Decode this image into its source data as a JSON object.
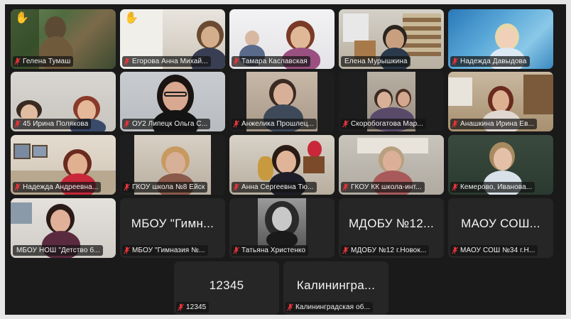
{
  "colors": {
    "tile_bg": "#262626",
    "active_border": "#23d959",
    "muted_mic": "#e8343a",
    "name_text": "#f2f2f2"
  },
  "hand_icon": "✋",
  "tiles": [
    {
      "name": "Гелена Тумаш",
      "type": "video",
      "hand": true
    },
    {
      "name": "Егорова Анна Михай...",
      "type": "video",
      "hand": true
    },
    {
      "name": "Тамара Каславская",
      "type": "video",
      "hand": false
    },
    {
      "name": "Елена Мурышкина",
      "type": "video",
      "hand": false,
      "active": true
    },
    {
      "name": "Надежда Давыдова",
      "type": "video",
      "hand": false
    },
    {
      "name": "45 Ирина Полякова",
      "type": "video",
      "hand": false
    },
    {
      "name": "ОУ2 Липецк Ольга С...",
      "type": "video",
      "hand": false
    },
    {
      "name": "Анжелика  Прошлец...",
      "type": "video",
      "hand": false
    },
    {
      "name": "Скоробогатова Мар...",
      "type": "video",
      "hand": false
    },
    {
      "name": "Анашкина Ирина Ев...",
      "type": "video",
      "hand": false
    },
    {
      "name": "Надежда Андреевна...",
      "type": "video",
      "hand": false
    },
    {
      "name": "ГКОУ школа №8 Ейск",
      "type": "video",
      "hand": false
    },
    {
      "name": "Анна Сергеевна Тю...",
      "type": "video",
      "hand": false
    },
    {
      "name": "ГКОУ КК школа-инт...",
      "type": "video",
      "hand": false
    },
    {
      "name": "Кемерово, Иванова...",
      "type": "video",
      "hand": false
    },
    {
      "name": "МБОУ НОШ \"Детство б...",
      "type": "video",
      "hand": false
    },
    {
      "name": "МБОУ \"Гимназия №...",
      "type": "label",
      "label": "МБОУ \"Гимн...",
      "hand": false
    },
    {
      "name": "Татьяна Христенко",
      "type": "photo",
      "hand": false
    },
    {
      "name": "МДОБУ №12 г.Новок...",
      "type": "label",
      "label": "МДОБУ №12...",
      "hand": false
    },
    {
      "name": "МАОУ СОШ №34 г.Н...",
      "type": "label",
      "label": "МАОУ СОШ...",
      "hand": false
    },
    {
      "name": "12345",
      "type": "label",
      "label": "12345",
      "hand": false
    },
    {
      "name": "Калининградская об...",
      "type": "label",
      "label": "Калинингра...",
      "hand": false
    }
  ]
}
